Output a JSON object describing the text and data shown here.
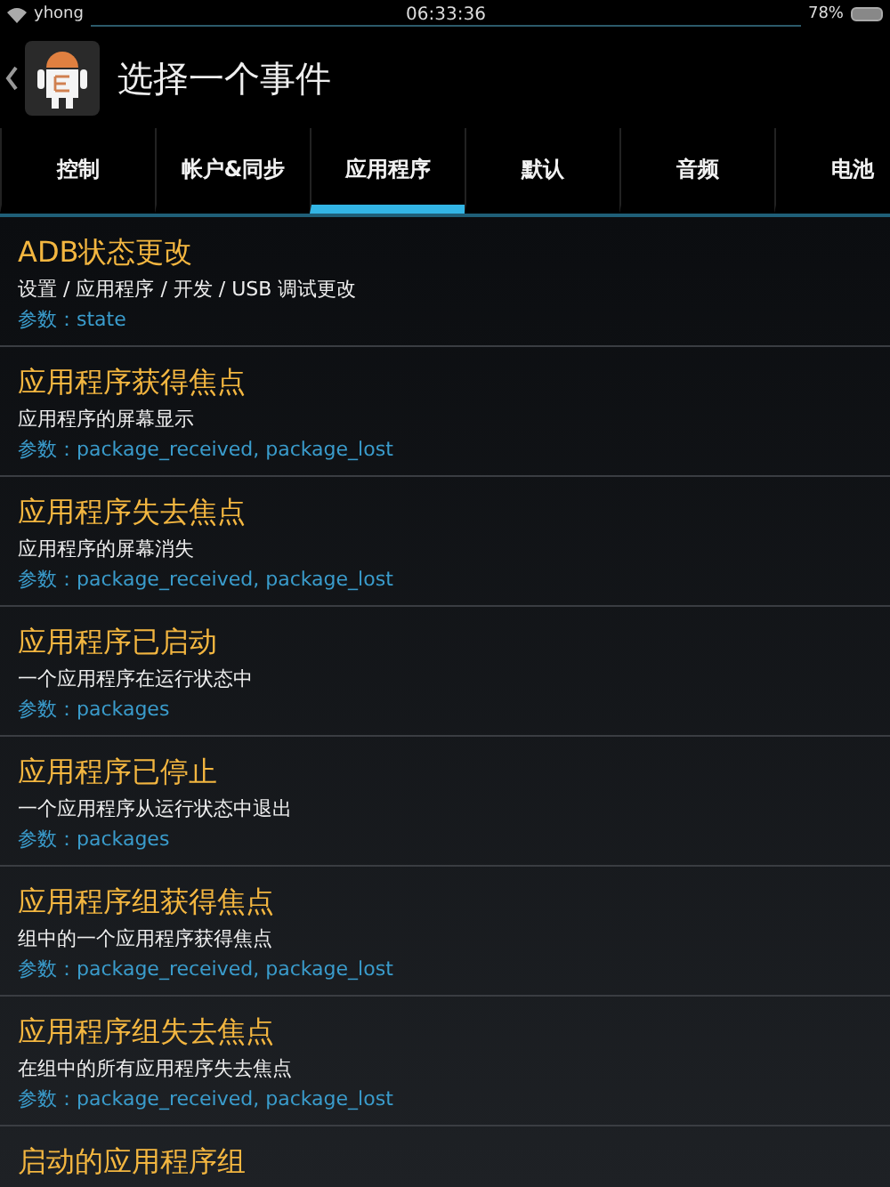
{
  "status_bar": {
    "network": "yhong",
    "time": "06:33:36",
    "battery": "78%"
  },
  "header": {
    "title": "选择一个事件"
  },
  "tabs": [
    {
      "label": "控制",
      "selected": false
    },
    {
      "label": "帐户&同步",
      "selected": false
    },
    {
      "label": "应用程序",
      "selected": true
    },
    {
      "label": "默认",
      "selected": false
    },
    {
      "label": "音频",
      "selected": false
    },
    {
      "label": "电池",
      "selected": false
    }
  ],
  "events": [
    {
      "title": "ADB状态更改",
      "description": "设置 / 应用程序 / 开发 / USB 调试更改",
      "params": "参数：state"
    },
    {
      "title": "应用程序获得焦点",
      "description": "应用程序的屏幕显示",
      "params": "参数：package_received, package_lost"
    },
    {
      "title": "应用程序失去焦点",
      "description": "应用程序的屏幕消失",
      "params": "参数：package_received, package_lost"
    },
    {
      "title": "应用程序已启动",
      "description": "一个应用程序在运行状态中",
      "params": "参数：packages"
    },
    {
      "title": "应用程序已停止",
      "description": "一个应用程序从运行状态中退出",
      "params": "参数：packages"
    },
    {
      "title": "应用程序组获得焦点",
      "description": "组中的一个应用程序获得焦点",
      "params": "参数：package_received, package_lost"
    },
    {
      "title": "应用程序组失去焦点",
      "description": "在组中的所有应用程序失去焦点",
      "params": "参数：package_received, package_lost"
    },
    {
      "title": "启动的应用程序组"
    }
  ]
}
